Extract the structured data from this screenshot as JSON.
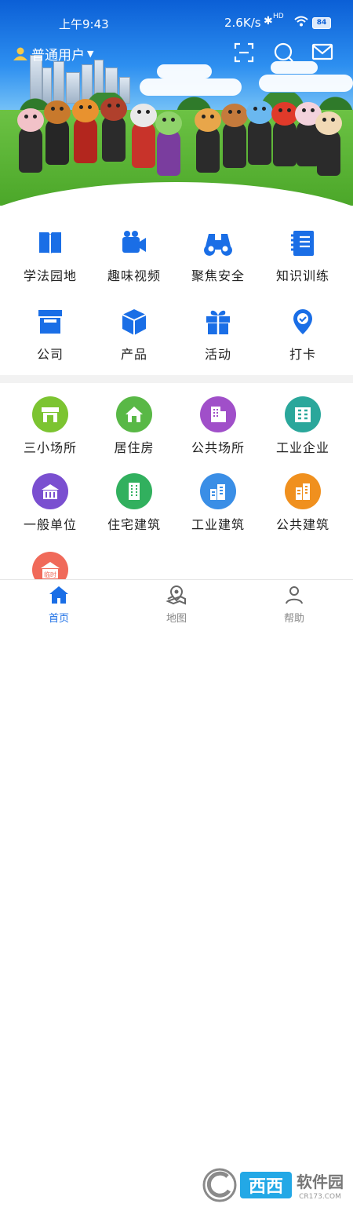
{
  "status_bar": {
    "time": "上午9:43",
    "network_speed": "2.6K/s",
    "hd_label": "HD",
    "battery": "84"
  },
  "header": {
    "user_label": "普通用户",
    "icons": [
      "scan-icon",
      "message-icon",
      "mail-icon"
    ]
  },
  "main_menu": [
    {
      "label": "学法园地",
      "icon": "book-icon"
    },
    {
      "label": "趣味视频",
      "icon": "video-camera-icon"
    },
    {
      "label": "聚焦安全",
      "icon": "binoculars-icon"
    },
    {
      "label": "知识训练",
      "icon": "notebook-icon"
    },
    {
      "label": "公司",
      "icon": "storefront-icon"
    },
    {
      "label": "产品",
      "icon": "box-icon"
    },
    {
      "label": "活动",
      "icon": "gift-icon"
    },
    {
      "label": "打卡",
      "icon": "location-check-icon"
    }
  ],
  "categories": [
    {
      "label": "三小场所",
      "icon": "shop-icon",
      "color": "#7cc431"
    },
    {
      "label": "居住房",
      "icon": "house-icon",
      "color": "#59b846"
    },
    {
      "label": "公共场所",
      "icon": "building-icon",
      "color": "#a04fc9"
    },
    {
      "label": "工业企业",
      "icon": "factory-icon",
      "color": "#2aa79b"
    },
    {
      "label": "一般单位",
      "icon": "office-icon",
      "color": "#7a4fd0"
    },
    {
      "label": "住宅建筑",
      "icon": "residential-icon",
      "color": "#31b05e"
    },
    {
      "label": "工业建筑",
      "icon": "industrial-icon",
      "color": "#3a8ee6"
    },
    {
      "label": "公共建筑",
      "icon": "public-building-icon",
      "color": "#f0901e"
    },
    {
      "label": "临时",
      "icon": "temporary-icon",
      "color": "#f06a5a"
    }
  ],
  "tab_bar": [
    {
      "label": "首页",
      "icon": "home-icon",
      "active": true
    },
    {
      "label": "地图",
      "icon": "map-icon",
      "active": false
    },
    {
      "label": "帮助",
      "icon": "help-icon",
      "active": false
    }
  ],
  "watermark": {
    "text_main": "西西软件园",
    "text_sub": "CR173.COM"
  },
  "colors": {
    "accent": "#1a6ee6",
    "tab_active": "#1a6ee6",
    "tab_inactive": "#888888"
  }
}
